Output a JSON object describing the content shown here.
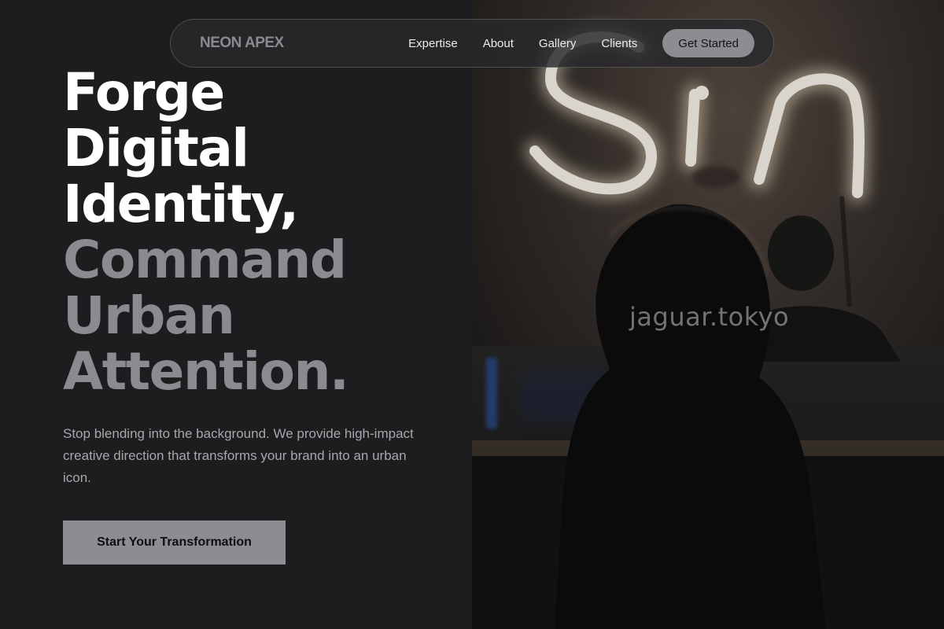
{
  "brand": {
    "name": "NEON APEX"
  },
  "nav": {
    "links": [
      "Expertise",
      "About",
      "Gallery",
      "Clients"
    ],
    "cta_label": "Get Started"
  },
  "hero": {
    "headline_light": [
      "Forge",
      "Digital",
      "Identity,"
    ],
    "headline_muted": [
      "Command",
      "Urban",
      "Attention."
    ],
    "description": "Stop blending into the background. We provide high-impact creative direction that transforms your brand into an urban icon.",
    "cta_label": "Start Your Transformation"
  },
  "photo": {
    "neon_sign_text": "Sin",
    "watermark": "jaguar.tokyo"
  },
  "colors": {
    "background": "#1d1d20",
    "text_primary": "#ffffff",
    "text_muted": "#8b8b8f",
    "button_fill": "#8c8c91",
    "neon_glow": "#fff6e0"
  }
}
